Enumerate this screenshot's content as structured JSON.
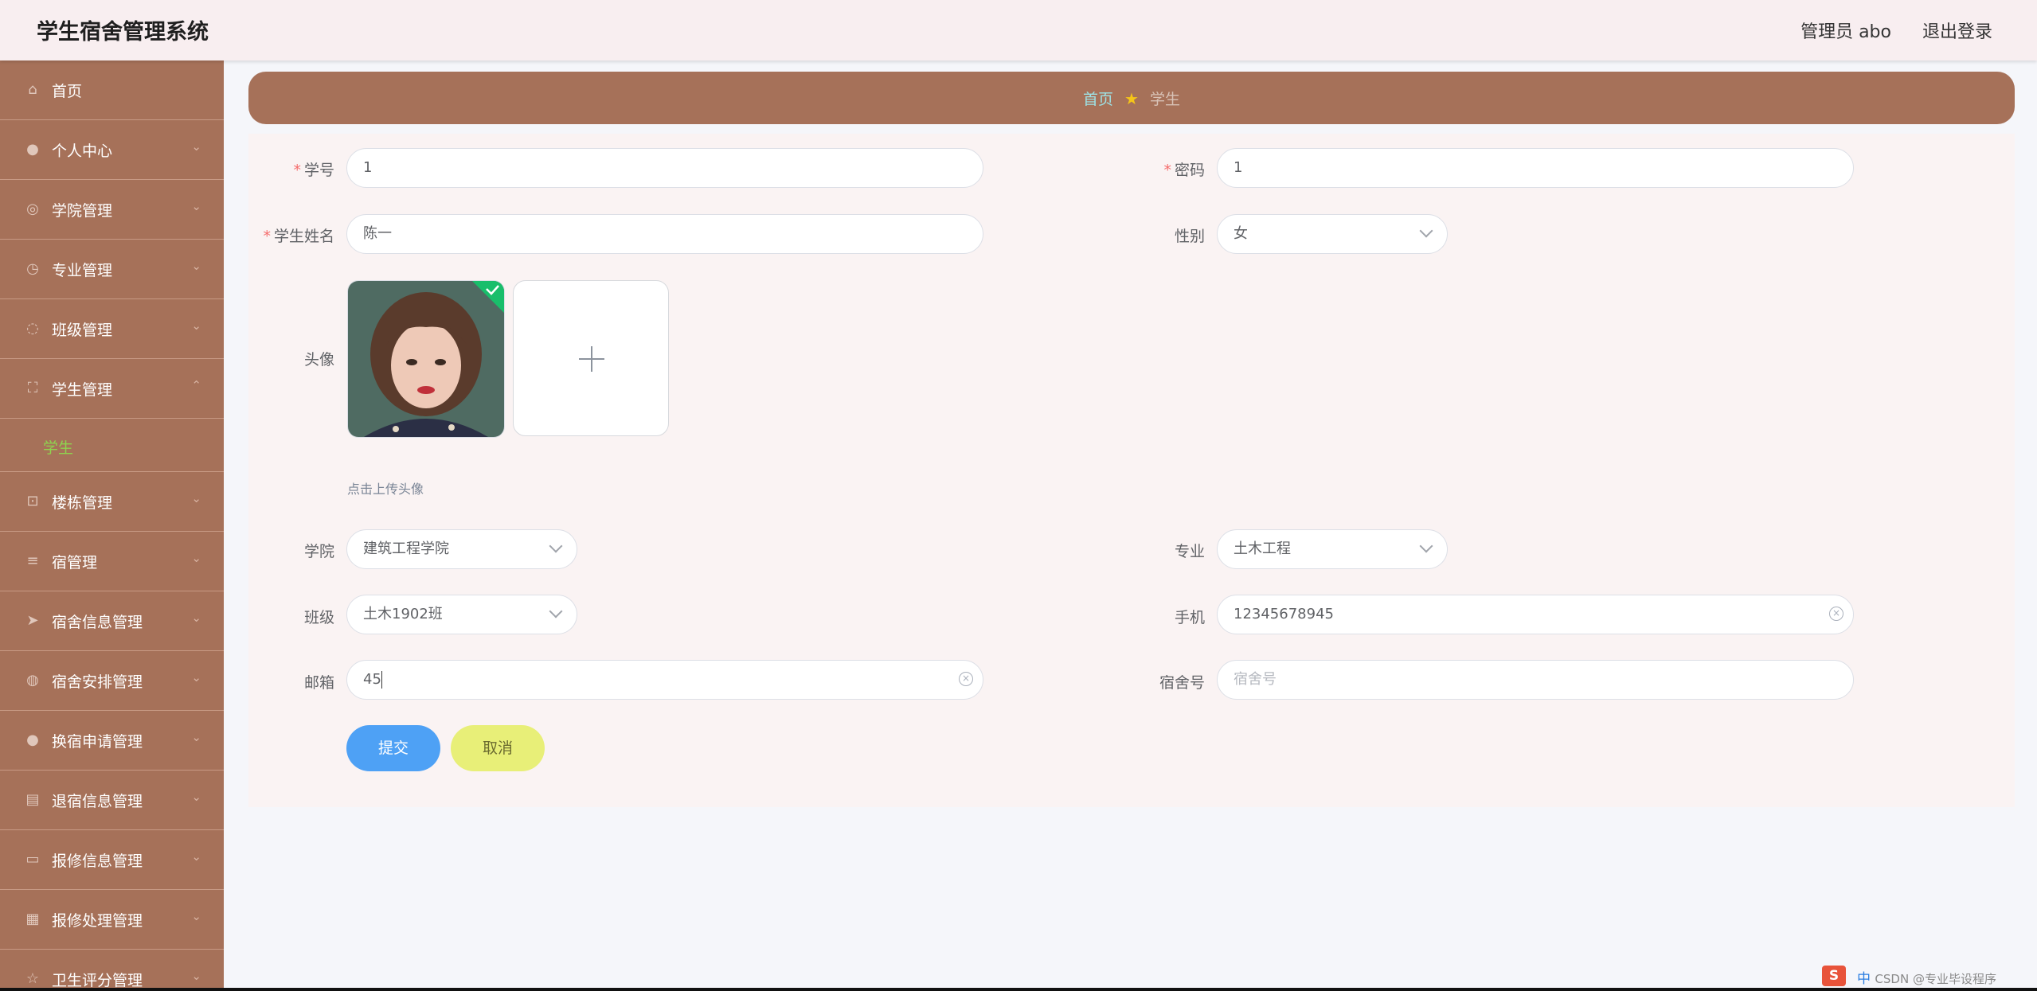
{
  "app": {
    "title": "学生宿舍管理系统"
  },
  "header": {
    "user_label": "管理员 abo",
    "logout_label": "退出登录"
  },
  "sidebar": {
    "items": [
      {
        "label": "首页",
        "icon": "home-icon",
        "glyph": "⌂",
        "arrow": ""
      },
      {
        "label": "个人中心",
        "icon": "user-icon",
        "glyph": "●",
        "arrow": "⌄"
      },
      {
        "label": "学院管理",
        "icon": "compass-icon",
        "glyph": "◎",
        "arrow": "⌄"
      },
      {
        "label": "专业管理",
        "icon": "clock-icon",
        "glyph": "◷",
        "arrow": "⌄"
      },
      {
        "label": "班级管理",
        "icon": "loading-icon",
        "glyph": "◌",
        "arrow": "⌄"
      },
      {
        "label": "学生管理",
        "icon": "fullscreen-icon",
        "glyph": "⛶",
        "arrow": "⌃"
      },
      {
        "label": "楼栋管理",
        "icon": "crop-icon",
        "glyph": "⊡",
        "arrow": "⌄"
      },
      {
        "label": "宿管理",
        "icon": "menu-icon",
        "glyph": "≡",
        "arrow": "⌄"
      },
      {
        "label": "宿舍信息管理",
        "icon": "send-icon",
        "glyph": "➤",
        "arrow": "⌄"
      },
      {
        "label": "宿舍安排管理",
        "icon": "basketball-icon",
        "glyph": "◍",
        "arrow": "⌄"
      },
      {
        "label": "换宿申请管理",
        "icon": "user-icon",
        "glyph": "●",
        "arrow": "⌄"
      },
      {
        "label": "退宿信息管理",
        "icon": "card-icon",
        "glyph": "▤",
        "arrow": "⌄"
      },
      {
        "label": "报修信息管理",
        "icon": "monitor-icon",
        "glyph": "▭",
        "arrow": "⌄"
      },
      {
        "label": "报修处理管理",
        "icon": "grid-icon",
        "glyph": "▦",
        "arrow": "⌄"
      },
      {
        "label": "卫生评分管理",
        "icon": "star-icon",
        "glyph": "☆",
        "arrow": "⌄"
      }
    ],
    "sub_item": "学生"
  },
  "breadcrumb": {
    "home": "首页",
    "current": "学生"
  },
  "form": {
    "student_id": {
      "label": "学号",
      "value": "1"
    },
    "password": {
      "label": "密码",
      "value": "1"
    },
    "student_name": {
      "label": "学生姓名",
      "value": "陈一"
    },
    "gender": {
      "label": "性别",
      "value": "女"
    },
    "avatar": {
      "label": "头像",
      "tip": "点击上传头像"
    },
    "college": {
      "label": "学院",
      "value": "建筑工程学院"
    },
    "major": {
      "label": "专业",
      "value": "土木工程"
    },
    "class": {
      "label": "班级",
      "value": "土木1902班"
    },
    "phone": {
      "label": "手机",
      "value": "12345678945"
    },
    "email": {
      "label": "邮箱",
      "value": "45"
    },
    "dorm": {
      "label": "宿舍号",
      "placeholder": "宿舍号"
    },
    "submit_label": "提交",
    "cancel_label": "取消"
  },
  "taskbar": {
    "ime_label": "中",
    "watermark": "CSDN @专业毕设程序"
  },
  "colors": {
    "sidebar_bg": "#a67159",
    "header_bg": "#f8eef0",
    "submit_bg": "#4ea1f5",
    "cancel_bg": "#e8ef78",
    "active_sub": "#8fd34f"
  }
}
